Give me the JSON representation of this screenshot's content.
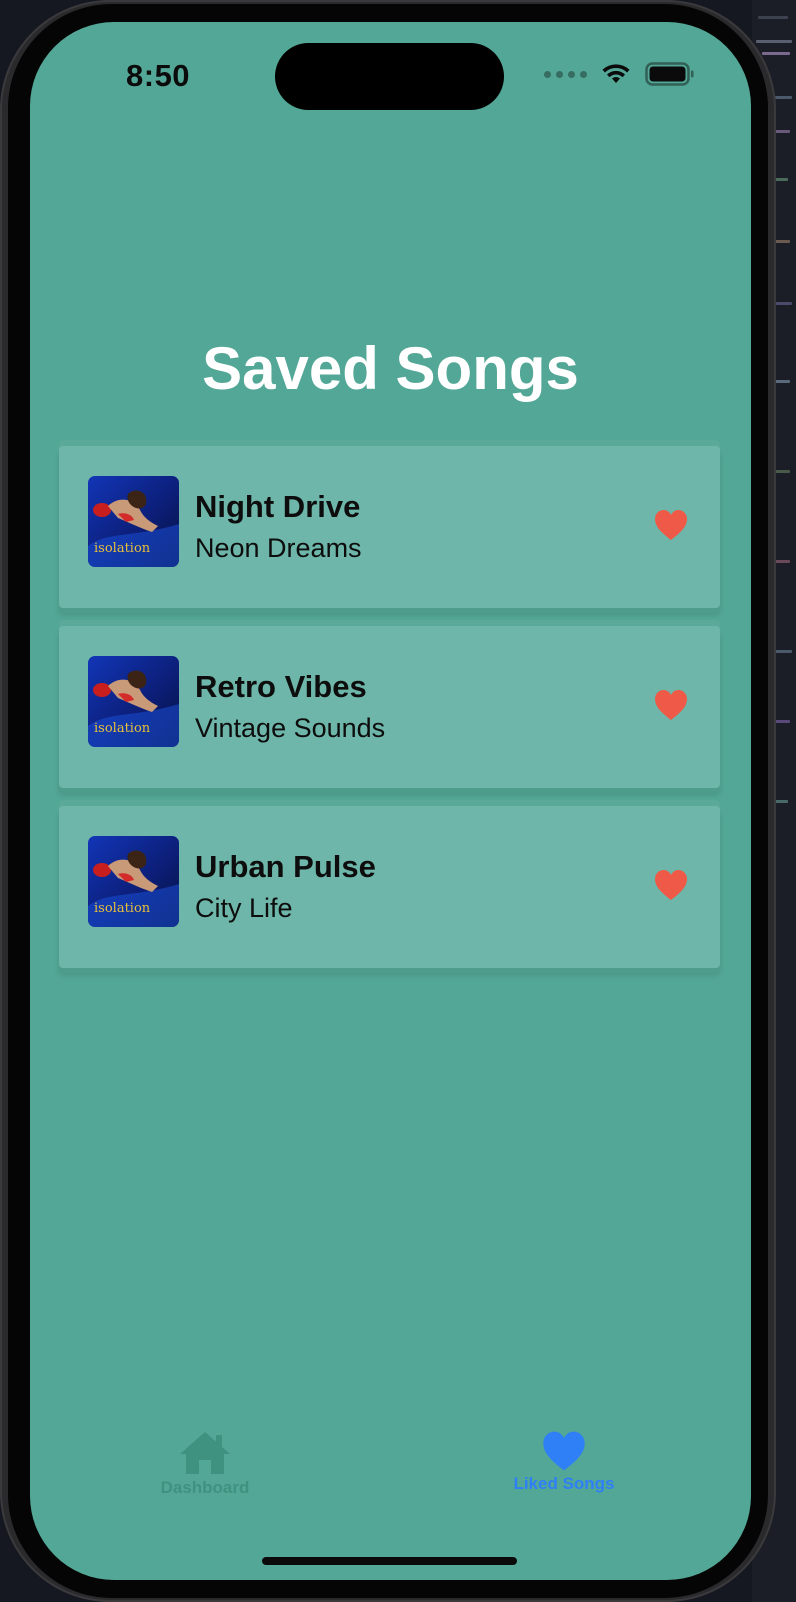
{
  "status_bar": {
    "time": "8:50"
  },
  "page": {
    "title": "Saved Songs"
  },
  "songs": [
    {
      "title": "Night Drive",
      "artist": "Neon Dreams",
      "album_art_text": "isolation",
      "liked": true
    },
    {
      "title": "Retro Vibes",
      "artist": "Vintage Sounds",
      "album_art_text": "isolation",
      "liked": true
    },
    {
      "title": "Urban Pulse",
      "artist": "City Life",
      "album_art_text": "isolation",
      "liked": true
    }
  ],
  "tab_bar": {
    "dashboard_label": "Dashboard",
    "liked_label": "Liked Songs",
    "active_tab": "Liked Songs"
  },
  "colors": {
    "background": "#53a796",
    "card": "#6db6a9",
    "heart": "#ee5a47",
    "tab_active": "#2f7ff6",
    "tab_inactive": "#3f9280"
  },
  "icons": {
    "like": "heart-icon",
    "dashboard_tab": "home-icon",
    "liked_tab": "heart-icon",
    "wifi": "wifi-icon",
    "battery": "battery-icon"
  }
}
